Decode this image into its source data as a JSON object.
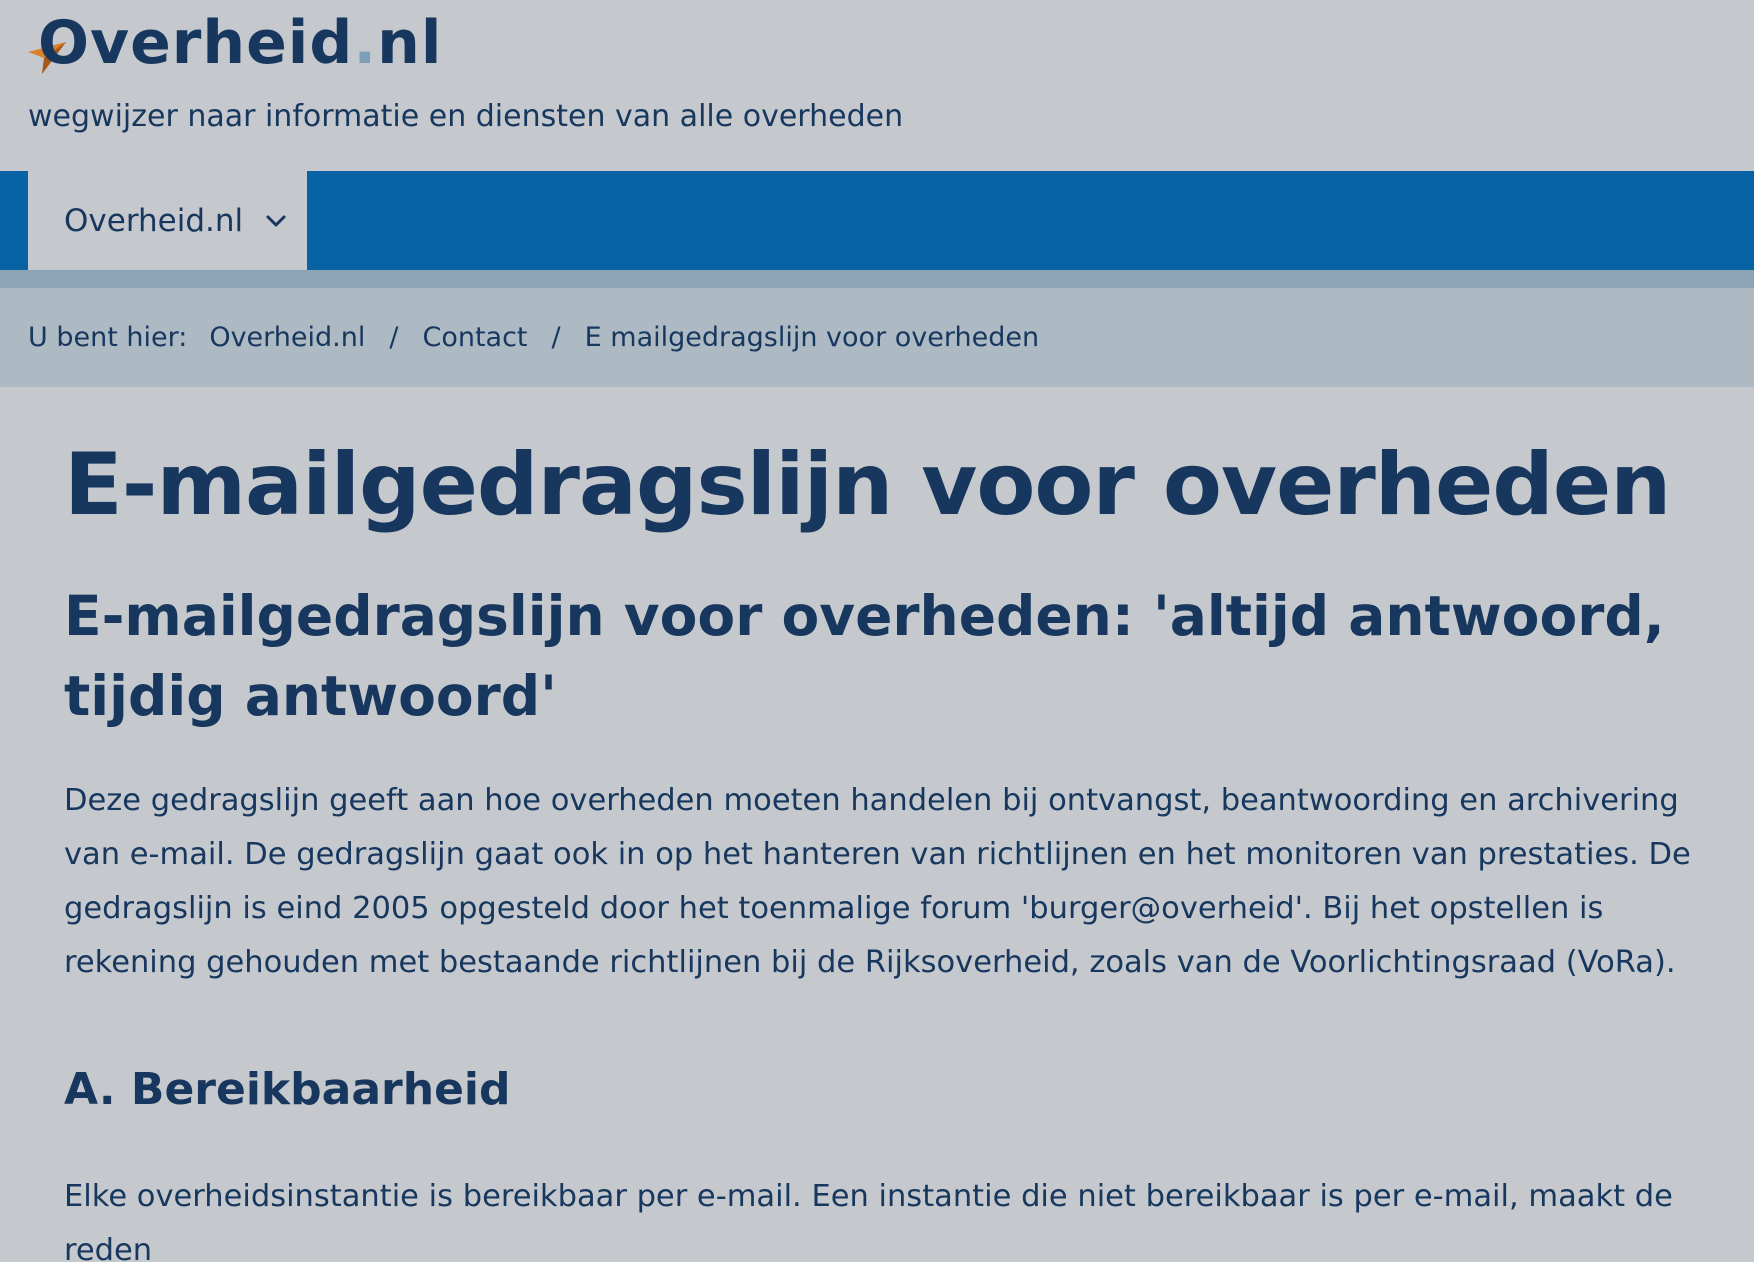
{
  "header": {
    "logo_main": "Overheid",
    "logo_dot": ".",
    "logo_tld": "nl",
    "tagline": "wegwijzer naar informatie en diensten van alle overheden"
  },
  "nav": {
    "item_label": "Overheid.nl"
  },
  "breadcrumb": {
    "prefix": "U bent hier:",
    "items": [
      "Overheid.nl",
      "Contact",
      "E mailgedragslijn voor overheden"
    ],
    "separator": "/"
  },
  "main": {
    "title": "E-mailgedragslijn voor overheden",
    "subtitle": "E-mailgedragslijn voor overheden: 'altijd antwoord, tijdig antwoord'",
    "intro": "Deze gedragslijn geeft aan hoe overheden moeten handelen bij ontvangst, beantwoording en archivering van e-mail. De gedragslijn gaat ook in op het hanteren van richtlijnen en het monitoren van prestaties. De gedragslijn is eind 2005 opgesteld door het toenmalige forum 'burger@overheid'. Bij het opstellen is rekening gehouden met bestaande richtlijnen bij de Rijksoverheid, zoals van de Voorlichtingsraad (VoRa).",
    "section_a_heading": "A. Bereikbaarheid",
    "section_a_text": "Elke overheidsinstantie is bereikbaar per e-mail. Een instantie die niet bereikbaar is per e-mail, maakt de reden"
  },
  "colors": {
    "background": "#c5c9cd",
    "navbar": "#0763a4",
    "breadcrumb_bg": "#adbac3",
    "text": "#17375e",
    "logo_accent": "#d9822b"
  },
  "icons": {
    "logo": "arrow-pointer-logo-icon",
    "nav_dropdown": "chevron-down-icon"
  }
}
